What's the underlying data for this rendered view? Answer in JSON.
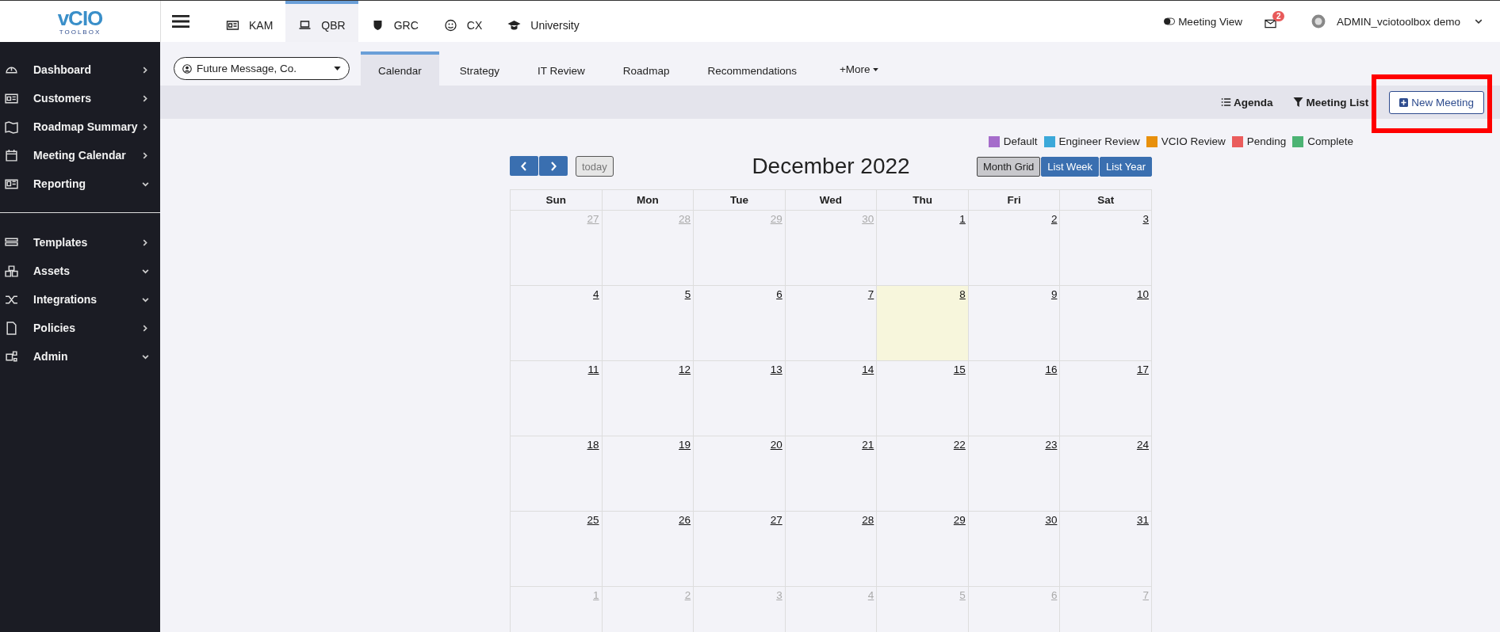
{
  "logo": {
    "text": "vCIO",
    "subtext": "TOOLBOX"
  },
  "sidebar": {
    "groups": [
      {
        "items": [
          {
            "label": "Dashboard",
            "kind": "link"
          },
          {
            "label": "Customers",
            "kind": "link"
          },
          {
            "label": "Roadmap Summary",
            "kind": "link"
          },
          {
            "label": "Meeting Calendar",
            "kind": "link"
          },
          {
            "label": "Reporting",
            "kind": "dropdown"
          }
        ]
      },
      {
        "items": [
          {
            "label": "Templates",
            "kind": "link"
          },
          {
            "label": "Assets",
            "kind": "dropdown"
          },
          {
            "label": "Integrations",
            "kind": "dropdown"
          },
          {
            "label": "Policies",
            "kind": "link"
          },
          {
            "label": "Admin",
            "kind": "dropdown"
          }
        ]
      }
    ]
  },
  "top_tabs": [
    {
      "label": "KAM",
      "selected": false
    },
    {
      "label": "QBR",
      "selected": true
    },
    {
      "label": "GRC",
      "selected": false
    },
    {
      "label": "CX",
      "selected": false
    },
    {
      "label": "University",
      "selected": false
    }
  ],
  "header": {
    "meeting_view": "Meeting View",
    "mail_count": "2",
    "user": "ADMIN_vciotoolbox demo"
  },
  "customer_select": {
    "value": "Future Message, Co."
  },
  "page_tabs": [
    {
      "label": "Calendar",
      "selected": true
    },
    {
      "label": "Strategy",
      "selected": false
    },
    {
      "label": "IT Review",
      "selected": false
    },
    {
      "label": "Roadmap",
      "selected": false
    },
    {
      "label": "Recommendations",
      "selected": false
    }
  ],
  "more": "+More",
  "toolbar": {
    "agenda": "Agenda",
    "meeting_list": "Meeting List",
    "new_meeting": "New Meeting"
  },
  "legend": [
    {
      "label": "Default",
      "color": "#a56ccb"
    },
    {
      "label": "Engineer Review",
      "color": "#3ba8d9"
    },
    {
      "label": "VCIO Review",
      "color": "#e8900c"
    },
    {
      "label": "Pending",
      "color": "#ea5c5c"
    },
    {
      "label": "Complete",
      "color": "#4cb374"
    }
  ],
  "calendar": {
    "today_button": {
      "label": "today",
      "disabled": true
    },
    "title": "December 2022",
    "views": [
      {
        "label": "Month Grid",
        "selected": true
      },
      {
        "label": "List Week",
        "selected": false
      },
      {
        "label": "List Year",
        "selected": false
      }
    ],
    "weekdays": [
      "Sun",
      "Mon",
      "Tue",
      "Wed",
      "Thu",
      "Fri",
      "Sat"
    ],
    "weeks": [
      [
        {
          "day": "27",
          "other_month": true,
          "today": false
        },
        {
          "day": "28",
          "other_month": true,
          "today": false
        },
        {
          "day": "29",
          "other_month": true,
          "today": false
        },
        {
          "day": "30",
          "other_month": true,
          "today": false
        },
        {
          "day": "1",
          "other_month": false,
          "today": false
        },
        {
          "day": "2",
          "other_month": false,
          "today": false
        },
        {
          "day": "3",
          "other_month": false,
          "today": false
        }
      ],
      [
        {
          "day": "4",
          "other_month": false,
          "today": false
        },
        {
          "day": "5",
          "other_month": false,
          "today": false
        },
        {
          "day": "6",
          "other_month": false,
          "today": false
        },
        {
          "day": "7",
          "other_month": false,
          "today": false
        },
        {
          "day": "8",
          "other_month": false,
          "today": true
        },
        {
          "day": "9",
          "other_month": false,
          "today": false
        },
        {
          "day": "10",
          "other_month": false,
          "today": false
        }
      ],
      [
        {
          "day": "11",
          "other_month": false,
          "today": false
        },
        {
          "day": "12",
          "other_month": false,
          "today": false
        },
        {
          "day": "13",
          "other_month": false,
          "today": false
        },
        {
          "day": "14",
          "other_month": false,
          "today": false
        },
        {
          "day": "15",
          "other_month": false,
          "today": false
        },
        {
          "day": "16",
          "other_month": false,
          "today": false
        },
        {
          "day": "17",
          "other_month": false,
          "today": false
        }
      ],
      [
        {
          "day": "18",
          "other_month": false,
          "today": false
        },
        {
          "day": "19",
          "other_month": false,
          "today": false
        },
        {
          "day": "20",
          "other_month": false,
          "today": false
        },
        {
          "day": "21",
          "other_month": false,
          "today": false
        },
        {
          "day": "22",
          "other_month": false,
          "today": false
        },
        {
          "day": "23",
          "other_month": false,
          "today": false
        },
        {
          "day": "24",
          "other_month": false,
          "today": false
        }
      ],
      [
        {
          "day": "25",
          "other_month": false,
          "today": false
        },
        {
          "day": "26",
          "other_month": false,
          "today": false
        },
        {
          "day": "27",
          "other_month": false,
          "today": false
        },
        {
          "day": "28",
          "other_month": false,
          "today": false
        },
        {
          "day": "29",
          "other_month": false,
          "today": false
        },
        {
          "day": "30",
          "other_month": false,
          "today": false
        },
        {
          "day": "31",
          "other_month": false,
          "today": false
        }
      ],
      [
        {
          "day": "1",
          "other_month": true,
          "today": false
        },
        {
          "day": "2",
          "other_month": true,
          "today": false
        },
        {
          "day": "3",
          "other_month": true,
          "today": false
        },
        {
          "day": "4",
          "other_month": true,
          "today": false
        },
        {
          "day": "5",
          "other_month": true,
          "today": false
        },
        {
          "day": "6",
          "other_month": true,
          "today": false
        },
        {
          "day": "7",
          "other_month": true,
          "today": false
        }
      ]
    ]
  }
}
